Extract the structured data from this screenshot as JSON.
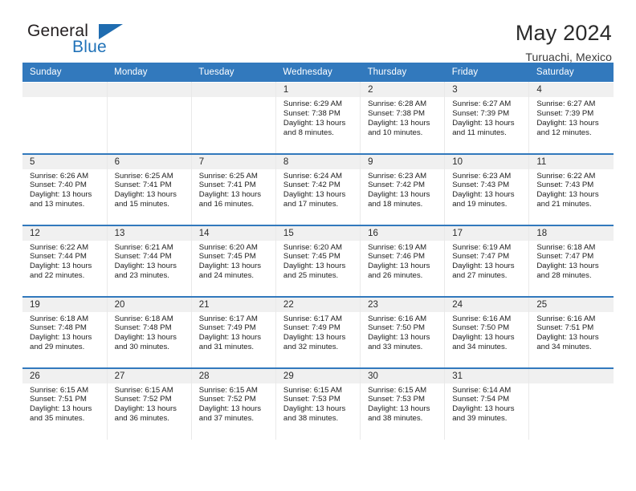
{
  "brand": {
    "word1": "General",
    "word2": "Blue",
    "triangle_icon": "blue-triangle-logo-mark",
    "color_black": "#231f20",
    "color_blue": "#2072b8"
  },
  "header": {
    "title": "May 2024",
    "location": "Turuachi, Mexico"
  },
  "theme": {
    "header_bg": "#3279bd",
    "header_text": "#ffffff",
    "daynum_band_bg": "#f0f0f0",
    "row_rule": "#3279bd",
    "cell_bg": "#ffffff"
  },
  "labels": {
    "sunrise_prefix": "Sunrise:",
    "sunset_prefix": "Sunset:",
    "daylight_prefix": "Daylight:"
  },
  "weekdays": [
    "Sunday",
    "Monday",
    "Tuesday",
    "Wednesday",
    "Thursday",
    "Friday",
    "Saturday"
  ],
  "weeks": [
    [
      {
        "empty": true
      },
      {
        "empty": true
      },
      {
        "empty": true
      },
      {
        "day": "1",
        "sunrise": "Sunrise: 6:29 AM",
        "sunset": "Sunset: 7:38 PM",
        "daylight_l1": "Daylight: 13 hours",
        "daylight_l2": "and 8 minutes."
      },
      {
        "day": "2",
        "sunrise": "Sunrise: 6:28 AM",
        "sunset": "Sunset: 7:38 PM",
        "daylight_l1": "Daylight: 13 hours",
        "daylight_l2": "and 10 minutes."
      },
      {
        "day": "3",
        "sunrise": "Sunrise: 6:27 AM",
        "sunset": "Sunset: 7:39 PM",
        "daylight_l1": "Daylight: 13 hours",
        "daylight_l2": "and 11 minutes."
      },
      {
        "day": "4",
        "sunrise": "Sunrise: 6:27 AM",
        "sunset": "Sunset: 7:39 PM",
        "daylight_l1": "Daylight: 13 hours",
        "daylight_l2": "and 12 minutes."
      }
    ],
    [
      {
        "day": "5",
        "sunrise": "Sunrise: 6:26 AM",
        "sunset": "Sunset: 7:40 PM",
        "daylight_l1": "Daylight: 13 hours",
        "daylight_l2": "and 13 minutes."
      },
      {
        "day": "6",
        "sunrise": "Sunrise: 6:25 AM",
        "sunset": "Sunset: 7:41 PM",
        "daylight_l1": "Daylight: 13 hours",
        "daylight_l2": "and 15 minutes."
      },
      {
        "day": "7",
        "sunrise": "Sunrise: 6:25 AM",
        "sunset": "Sunset: 7:41 PM",
        "daylight_l1": "Daylight: 13 hours",
        "daylight_l2": "and 16 minutes."
      },
      {
        "day": "8",
        "sunrise": "Sunrise: 6:24 AM",
        "sunset": "Sunset: 7:42 PM",
        "daylight_l1": "Daylight: 13 hours",
        "daylight_l2": "and 17 minutes."
      },
      {
        "day": "9",
        "sunrise": "Sunrise: 6:23 AM",
        "sunset": "Sunset: 7:42 PM",
        "daylight_l1": "Daylight: 13 hours",
        "daylight_l2": "and 18 minutes."
      },
      {
        "day": "10",
        "sunrise": "Sunrise: 6:23 AM",
        "sunset": "Sunset: 7:43 PM",
        "daylight_l1": "Daylight: 13 hours",
        "daylight_l2": "and 19 minutes."
      },
      {
        "day": "11",
        "sunrise": "Sunrise: 6:22 AM",
        "sunset": "Sunset: 7:43 PM",
        "daylight_l1": "Daylight: 13 hours",
        "daylight_l2": "and 21 minutes."
      }
    ],
    [
      {
        "day": "12",
        "sunrise": "Sunrise: 6:22 AM",
        "sunset": "Sunset: 7:44 PM",
        "daylight_l1": "Daylight: 13 hours",
        "daylight_l2": "and 22 minutes."
      },
      {
        "day": "13",
        "sunrise": "Sunrise: 6:21 AM",
        "sunset": "Sunset: 7:44 PM",
        "daylight_l1": "Daylight: 13 hours",
        "daylight_l2": "and 23 minutes."
      },
      {
        "day": "14",
        "sunrise": "Sunrise: 6:20 AM",
        "sunset": "Sunset: 7:45 PM",
        "daylight_l1": "Daylight: 13 hours",
        "daylight_l2": "and 24 minutes."
      },
      {
        "day": "15",
        "sunrise": "Sunrise: 6:20 AM",
        "sunset": "Sunset: 7:45 PM",
        "daylight_l1": "Daylight: 13 hours",
        "daylight_l2": "and 25 minutes."
      },
      {
        "day": "16",
        "sunrise": "Sunrise: 6:19 AM",
        "sunset": "Sunset: 7:46 PM",
        "daylight_l1": "Daylight: 13 hours",
        "daylight_l2": "and 26 minutes."
      },
      {
        "day": "17",
        "sunrise": "Sunrise: 6:19 AM",
        "sunset": "Sunset: 7:47 PM",
        "daylight_l1": "Daylight: 13 hours",
        "daylight_l2": "and 27 minutes."
      },
      {
        "day": "18",
        "sunrise": "Sunrise: 6:18 AM",
        "sunset": "Sunset: 7:47 PM",
        "daylight_l1": "Daylight: 13 hours",
        "daylight_l2": "and 28 minutes."
      }
    ],
    [
      {
        "day": "19",
        "sunrise": "Sunrise: 6:18 AM",
        "sunset": "Sunset: 7:48 PM",
        "daylight_l1": "Daylight: 13 hours",
        "daylight_l2": "and 29 minutes."
      },
      {
        "day": "20",
        "sunrise": "Sunrise: 6:18 AM",
        "sunset": "Sunset: 7:48 PM",
        "daylight_l1": "Daylight: 13 hours",
        "daylight_l2": "and 30 minutes."
      },
      {
        "day": "21",
        "sunrise": "Sunrise: 6:17 AM",
        "sunset": "Sunset: 7:49 PM",
        "daylight_l1": "Daylight: 13 hours",
        "daylight_l2": "and 31 minutes."
      },
      {
        "day": "22",
        "sunrise": "Sunrise: 6:17 AM",
        "sunset": "Sunset: 7:49 PM",
        "daylight_l1": "Daylight: 13 hours",
        "daylight_l2": "and 32 minutes."
      },
      {
        "day": "23",
        "sunrise": "Sunrise: 6:16 AM",
        "sunset": "Sunset: 7:50 PM",
        "daylight_l1": "Daylight: 13 hours",
        "daylight_l2": "and 33 minutes."
      },
      {
        "day": "24",
        "sunrise": "Sunrise: 6:16 AM",
        "sunset": "Sunset: 7:50 PM",
        "daylight_l1": "Daylight: 13 hours",
        "daylight_l2": "and 34 minutes."
      },
      {
        "day": "25",
        "sunrise": "Sunrise: 6:16 AM",
        "sunset": "Sunset: 7:51 PM",
        "daylight_l1": "Daylight: 13 hours",
        "daylight_l2": "and 34 minutes."
      }
    ],
    [
      {
        "day": "26",
        "sunrise": "Sunrise: 6:15 AM",
        "sunset": "Sunset: 7:51 PM",
        "daylight_l1": "Daylight: 13 hours",
        "daylight_l2": "and 35 minutes."
      },
      {
        "day": "27",
        "sunrise": "Sunrise: 6:15 AM",
        "sunset": "Sunset: 7:52 PM",
        "daylight_l1": "Daylight: 13 hours",
        "daylight_l2": "and 36 minutes."
      },
      {
        "day": "28",
        "sunrise": "Sunrise: 6:15 AM",
        "sunset": "Sunset: 7:52 PM",
        "daylight_l1": "Daylight: 13 hours",
        "daylight_l2": "and 37 minutes."
      },
      {
        "day": "29",
        "sunrise": "Sunrise: 6:15 AM",
        "sunset": "Sunset: 7:53 PM",
        "daylight_l1": "Daylight: 13 hours",
        "daylight_l2": "and 38 minutes."
      },
      {
        "day": "30",
        "sunrise": "Sunrise: 6:15 AM",
        "sunset": "Sunset: 7:53 PM",
        "daylight_l1": "Daylight: 13 hours",
        "daylight_l2": "and 38 minutes."
      },
      {
        "day": "31",
        "sunrise": "Sunrise: 6:14 AM",
        "sunset": "Sunset: 7:54 PM",
        "daylight_l1": "Daylight: 13 hours",
        "daylight_l2": "and 39 minutes."
      },
      {
        "empty": true
      }
    ]
  ]
}
